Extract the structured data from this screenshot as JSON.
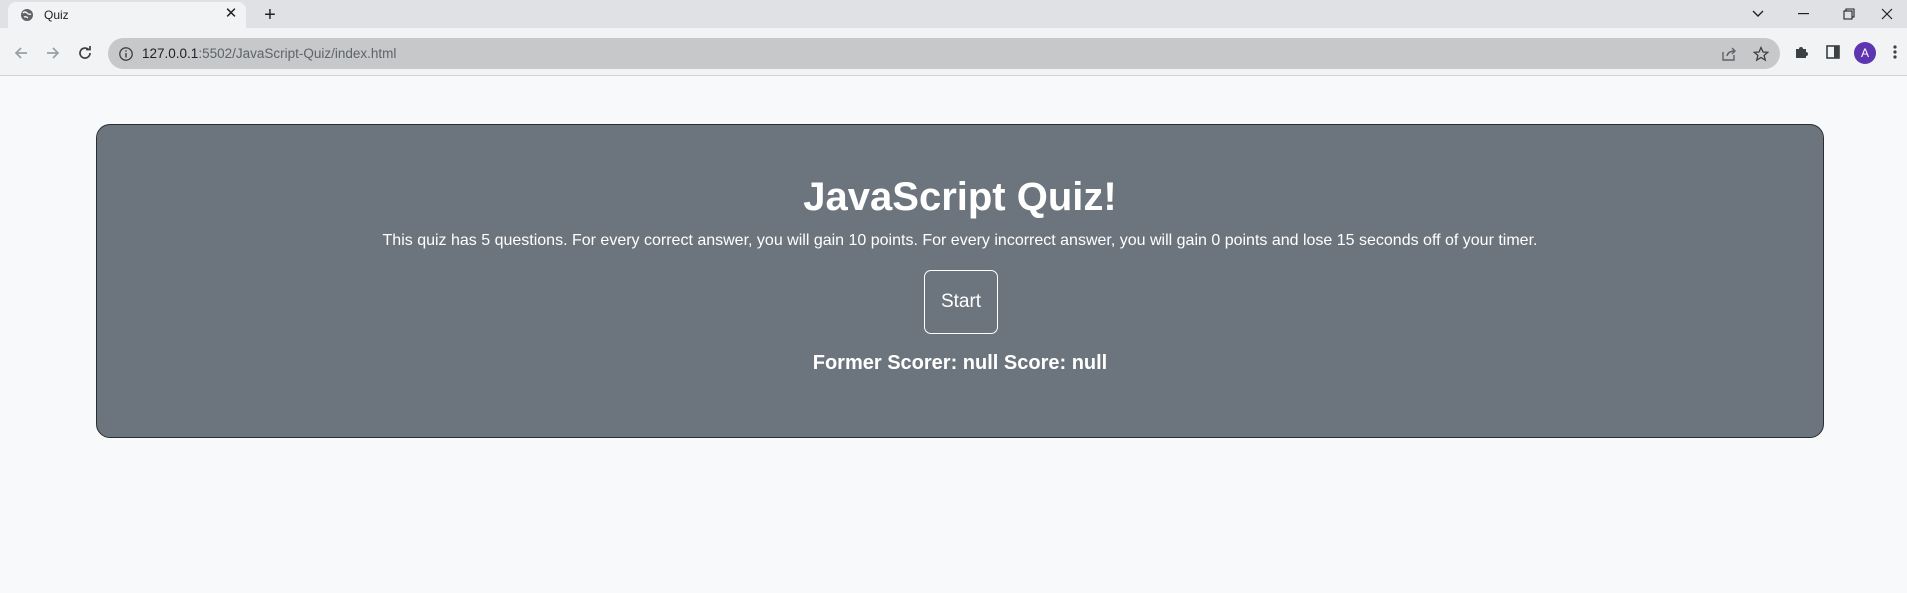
{
  "browser": {
    "tab_title": "Quiz",
    "url_host": "127.0.0.1",
    "url_path": ":5502/JavaScript-Quiz/index.html",
    "profile_initial": "A"
  },
  "quiz": {
    "title": "JavaScript Quiz!",
    "description": "This quiz has 5 questions. For every correct answer, you will gain 10 points. For every incorrect answer, you will gain 0 points and lose 15 seconds off of your timer.",
    "start_label": "Start",
    "former_score": "Former Scorer: null Score: null"
  },
  "colors": {
    "card_background": "#6c757d",
    "page_background": "#f8f9fa",
    "avatar": "#5e35b1"
  },
  "icons": {
    "tab_favicon": "globe-icon",
    "tab_close": "close-icon",
    "new_tab": "plus-icon",
    "back": "back-arrow-icon",
    "forward": "forward-arrow-icon",
    "reload": "reload-icon",
    "site_info": "info-icon",
    "share": "share-icon",
    "bookmark": "star-icon",
    "extensions": "puzzle-icon",
    "side_panel": "side-panel-icon",
    "menu": "kebab-menu-icon",
    "tab_search": "chevron-down-icon",
    "minimize": "minimize-icon",
    "restore": "restore-icon",
    "close_window": "close-window-icon"
  }
}
